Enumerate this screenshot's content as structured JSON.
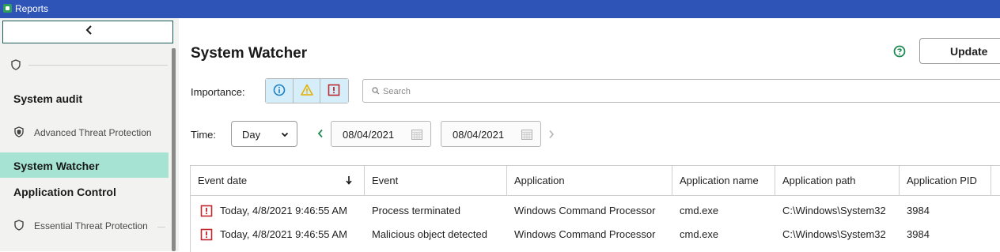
{
  "window": {
    "title": "Reports"
  },
  "sidebar": {
    "sections": [
      {
        "label": "System audit",
        "sub_label": "Advanced Threat Protection"
      },
      {
        "label": "System Watcher",
        "active": true
      },
      {
        "label": "Application Control",
        "sub_label": "Essential Threat Protection"
      }
    ]
  },
  "page": {
    "title": "System Watcher",
    "update_label": "Update"
  },
  "filters": {
    "importance_label": "Importance:",
    "search_placeholder": "Search",
    "time_label": "Time:",
    "period_value": "Day",
    "date_from": "08/04/2021",
    "date_to": "08/04/2021"
  },
  "table": {
    "columns": [
      "Event date",
      "Event",
      "Application",
      "Application name",
      "Application path",
      "Application PID"
    ],
    "rows": [
      {
        "severity": "critical",
        "event_date": "Today, 4/8/2021 9:46:55 AM",
        "event": "Process terminated",
        "application": "Windows Command Processor",
        "application_name": "cmd.exe",
        "application_path": "C:\\Windows\\System32",
        "pid": "3984"
      },
      {
        "severity": "critical",
        "event_date": "Today, 4/8/2021 9:46:55 AM",
        "event": "Malicious object detected",
        "application": "Windows Command Processor",
        "application_name": "cmd.exe",
        "application_path": "C:\\Windows\\System32",
        "pid": "3984"
      }
    ]
  },
  "colors": {
    "accent": "#2f54b8",
    "active_nav": "#a6e3d2",
    "critical": "#c0262d",
    "warning": "#e5b100",
    "info": "#1c7fc4"
  }
}
